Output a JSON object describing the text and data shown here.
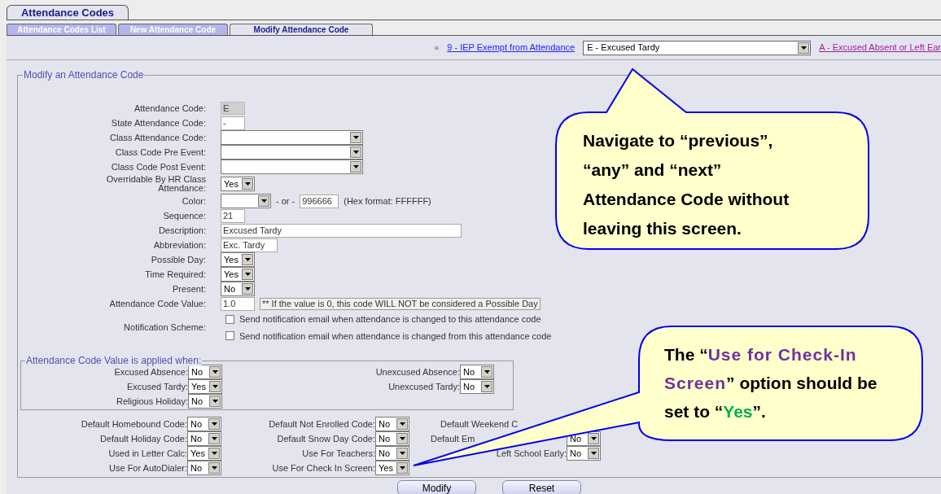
{
  "main_tabs": [
    {
      "label": "Attendance Codes",
      "selected": true
    }
  ],
  "sub_tabs": [
    {
      "label": "Attendance Codes List",
      "selected": false
    },
    {
      "label": "New Attendance Code",
      "selected": false
    },
    {
      "label": "Modify Attendance Code",
      "selected": true
    }
  ],
  "navigator": {
    "previous_marker": "«",
    "previous_link": "9 - IEP Exempt from Attendance",
    "current": "E - Excused Tardy",
    "next_link": "A - Excused Absent or Left Ear"
  },
  "form": {
    "title": "Modify an Attendance Code",
    "fields": [
      {
        "kind": "readonly",
        "label": "Attendance Code:",
        "value": "E"
      },
      {
        "kind": "text",
        "label": "State Attendance Code:",
        "value": "-"
      },
      {
        "kind": "select",
        "label": "Class Attendance Code:"
      },
      {
        "kind": "select",
        "label": "Class Code Pre Event:"
      },
      {
        "kind": "select",
        "label": "Class Code Post Event:"
      },
      {
        "kind": "select",
        "label": "Overridable By HR Class Attendance:",
        "value": "Yes"
      },
      {
        "kind": "color",
        "label": "Color:",
        "separator": "- or -",
        "value": "996666",
        "hint": "(Hex format: FFFFFF)"
      },
      {
        "kind": "text",
        "label": "Sequence:",
        "value": "21"
      },
      {
        "kind": "text",
        "label": "Description:",
        "value": "Excused Tardy"
      },
      {
        "kind": "text",
        "label": "Abbreviation:",
        "value": "Exc. Tardy"
      },
      {
        "kind": "select",
        "label": "Possible Day:",
        "value": "Yes"
      },
      {
        "kind": "select",
        "label": "Time Required:",
        "value": "Yes"
      },
      {
        "kind": "select",
        "label": "Present:",
        "value": "No"
      },
      {
        "kind": "note",
        "label": "Attendance Code Value:",
        "value": "1.0",
        "note": "** If the value is 0, this code WILL NOT be considered a Possible Day"
      },
      {
        "kind": "checkboxes",
        "label": "Notification Scheme:",
        "options": [
          {
            "label": "Send notification email when attendance is changed to this attendance code",
            "checked": false
          },
          {
            "label": "Send notification email when attendance is changed from this attendance code",
            "checked": false
          }
        ]
      }
    ],
    "applied_when": {
      "title": "Attendance Code Value is applied when:",
      "columns": [
        [
          {
            "label": "Excused Absence:",
            "value": "No"
          },
          {
            "label": "Excused Tardy:",
            "value": "Yes"
          },
          {
            "label": "Religious Holiday:",
            "value": "No"
          }
        ],
        [
          {
            "label": "Unexcused Absence:",
            "value": "No"
          },
          {
            "label": "Unexcused Tardy:",
            "value": "No"
          }
        ]
      ]
    },
    "defaults": [
      [
        {
          "label": "Default Homebound Code:",
          "value": "No"
        },
        {
          "label": "Default Holiday Code:",
          "value": "No"
        },
        {
          "label": "Used in Letter Calc:",
          "value": "Yes"
        },
        {
          "label": "Use For AutoDialer:",
          "value": "No"
        }
      ],
      [
        {
          "label": "Default Not Enrolled Code:",
          "value": "No"
        },
        {
          "label": "Default Snow Day Code:",
          "value": "No"
        },
        {
          "label": "Use For Teachers:",
          "value": "No"
        },
        {
          "label": "Use For Check In Screen:",
          "value": "Yes"
        }
      ],
      [
        {
          "label": "Default Weekend C"
        },
        {
          "label": "Default Em",
          "value": "No"
        },
        {
          "label": "Left School Early:",
          "value": "No"
        }
      ]
    ]
  },
  "buttons": [
    "Modify",
    "Reset"
  ],
  "callouts": [
    {
      "segments": [
        {
          "kind": "plain",
          "text": "Navigate to “previous”, “any” and “next” Attendance Code without leaving this screen."
        }
      ]
    },
    {
      "segments": [
        {
          "kind": "plain",
          "text": "The “"
        },
        {
          "kind": "option",
          "text": "Use for Check-In Screen"
        },
        {
          "kind": "plain",
          "text": "” option should be set to “"
        },
        {
          "kind": "value",
          "text": "Yes"
        },
        {
          "kind": "plain",
          "text": "”."
        }
      ]
    }
  ]
}
